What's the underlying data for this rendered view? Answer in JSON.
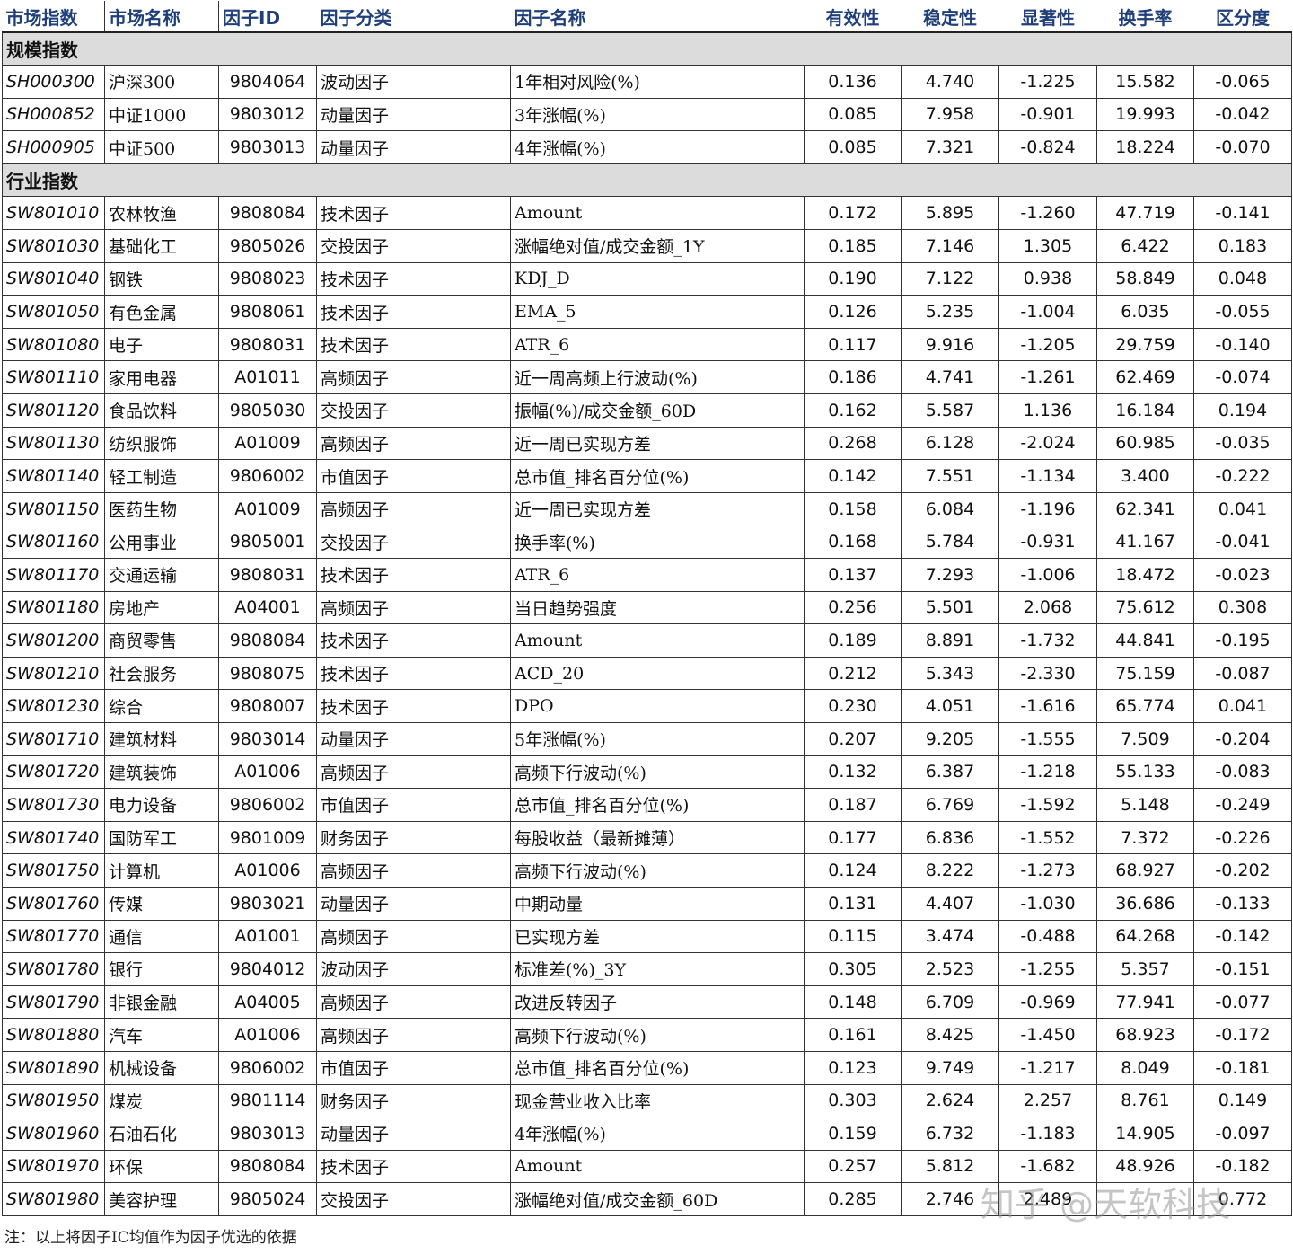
{
  "headers": [
    "市场指数",
    "市场名称",
    "因子ID",
    "因子分类",
    "因子名称",
    "有效性",
    "稳定性",
    "显著性",
    "换手率",
    "区分度"
  ],
  "sections": [
    {
      "title": "规模指数",
      "rows": [
        [
          "SH000300",
          "沪深300",
          "9804064",
          "波动因子",
          "1年相对风险(%)",
          "0.136",
          "4.740",
          "-1.225",
          "15.582",
          "-0.065"
        ],
        [
          "SH000852",
          "中证1000",
          "9803012",
          "动量因子",
          "3年涨幅(%)",
          "0.085",
          "7.958",
          "-0.901",
          "19.993",
          "-0.042"
        ],
        [
          "SH000905",
          "中证500",
          "9803013",
          "动量因子",
          "4年涨幅(%)",
          "0.085",
          "7.321",
          "-0.824",
          "18.224",
          "-0.070"
        ]
      ]
    },
    {
      "title": "行业指数",
      "rows": [
        [
          "SW801010",
          "农林牧渔",
          "9808084",
          "技术因子",
          "Amount",
          "0.172",
          "5.895",
          "-1.260",
          "47.719",
          "-0.141"
        ],
        [
          "SW801030",
          "基础化工",
          "9805026",
          "交投因子",
          "涨幅绝对值/成交金额_1Y",
          "0.185",
          "7.146",
          "1.305",
          "6.422",
          "0.183"
        ],
        [
          "SW801040",
          "钢铁",
          "9808023",
          "技术因子",
          "KDJ_D",
          "0.190",
          "7.122",
          "0.938",
          "58.849",
          "0.048"
        ],
        [
          "SW801050",
          "有色金属",
          "9808061",
          "技术因子",
          "EMA_5",
          "0.126",
          "5.235",
          "-1.004",
          "6.035",
          "-0.055"
        ],
        [
          "SW801080",
          "电子",
          "9808031",
          "技术因子",
          "ATR_6",
          "0.117",
          "9.916",
          "-1.205",
          "29.759",
          "-0.140"
        ],
        [
          "SW801110",
          "家用电器",
          "A01011",
          "高频因子",
          "近一周高频上行波动(%)",
          "0.186",
          "4.741",
          "-1.261",
          "62.469",
          "-0.074"
        ],
        [
          "SW801120",
          "食品饮料",
          "9805030",
          "交投因子",
          "振幅(%)/成交金额_60D",
          "0.162",
          "5.587",
          "1.136",
          "16.184",
          "0.194"
        ],
        [
          "SW801130",
          "纺织服饰",
          "A01009",
          "高频因子",
          "近一周已实现方差",
          "0.268",
          "6.128",
          "-2.024",
          "60.985",
          "-0.035"
        ],
        [
          "SW801140",
          "轻工制造",
          "9806002",
          "市值因子",
          "总市值_排名百分位(%)",
          "0.142",
          "7.551",
          "-1.134",
          "3.400",
          "-0.222"
        ],
        [
          "SW801150",
          "医药生物",
          "A01009",
          "高频因子",
          "近一周已实现方差",
          "0.158",
          "6.084",
          "-1.196",
          "62.341",
          "0.041"
        ],
        [
          "SW801160",
          "公用事业",
          "9805001",
          "交投因子",
          "换手率(%)",
          "0.168",
          "5.784",
          "-0.931",
          "41.167",
          "-0.041"
        ],
        [
          "SW801170",
          "交通运输",
          "9808031",
          "技术因子",
          "ATR_6",
          "0.137",
          "7.293",
          "-1.006",
          "18.472",
          "-0.023"
        ],
        [
          "SW801180",
          "房地产",
          "A04001",
          "高频因子",
          "当日趋势强度",
          "0.256",
          "5.501",
          "2.068",
          "75.612",
          "0.308"
        ],
        [
          "SW801200",
          "商贸零售",
          "9808084",
          "技术因子",
          "Amount",
          "0.189",
          "8.891",
          "-1.732",
          "44.841",
          "-0.195"
        ],
        [
          "SW801210",
          "社会服务",
          "9808075",
          "技术因子",
          "ACD_20",
          "0.212",
          "5.343",
          "-2.330",
          "75.159",
          "-0.087"
        ],
        [
          "SW801230",
          "综合",
          "9808007",
          "技术因子",
          "DPO",
          "0.230",
          "4.051",
          "-1.616",
          "65.774",
          "0.041"
        ],
        [
          "SW801710",
          "建筑材料",
          "9803014",
          "动量因子",
          "5年涨幅(%)",
          "0.207",
          "9.205",
          "-1.555",
          "7.509",
          "-0.204"
        ],
        [
          "SW801720",
          "建筑装饰",
          "A01006",
          "高频因子",
          "高频下行波动(%)",
          "0.132",
          "6.387",
          "-1.218",
          "55.133",
          "-0.083"
        ],
        [
          "SW801730",
          "电力设备",
          "9806002",
          "市值因子",
          "总市值_排名百分位(%)",
          "0.187",
          "6.769",
          "-1.592",
          "5.148",
          "-0.249"
        ],
        [
          "SW801740",
          "国防军工",
          "9801009",
          "财务因子",
          "每股收益（最新摊薄）",
          "0.177",
          "6.836",
          "-1.552",
          "7.372",
          "-0.226"
        ],
        [
          "SW801750",
          "计算机",
          "A01006",
          "高频因子",
          "高频下行波动(%)",
          "0.124",
          "8.222",
          "-1.273",
          "68.927",
          "-0.202"
        ],
        [
          "SW801760",
          "传媒",
          "9803021",
          "动量因子",
          "中期动量",
          "0.131",
          "4.407",
          "-1.030",
          "36.686",
          "-0.133"
        ],
        [
          "SW801770",
          "通信",
          "A01001",
          "高频因子",
          "已实现方差",
          "0.115",
          "3.474",
          "-0.488",
          "64.268",
          "-0.142"
        ],
        [
          "SW801780",
          "银行",
          "9804012",
          "波动因子",
          "标准差(%)_3Y",
          "0.305",
          "2.523",
          "-1.255",
          "5.357",
          "-0.151"
        ],
        [
          "SW801790",
          "非银金融",
          "A04005",
          "高频因子",
          "改进反转因子",
          "0.148",
          "6.709",
          "-0.969",
          "77.941",
          "-0.077"
        ],
        [
          "SW801880",
          "汽车",
          "A01006",
          "高频因子",
          "高频下行波动(%)",
          "0.161",
          "8.425",
          "-1.450",
          "68.923",
          "-0.172"
        ],
        [
          "SW801890",
          "机械设备",
          "9806002",
          "市值因子",
          "总市值_排名百分位(%)",
          "0.123",
          "9.749",
          "-1.217",
          "8.049",
          "-0.181"
        ],
        [
          "SW801950",
          "煤炭",
          "9801114",
          "财务因子",
          "现金营业收入比率",
          "0.303",
          "2.624",
          "2.257",
          "8.761",
          "0.149"
        ],
        [
          "SW801960",
          "石油石化",
          "9803013",
          "动量因子",
          "4年涨幅(%)",
          "0.159",
          "6.732",
          "-1.183",
          "14.905",
          "-0.097"
        ],
        [
          "SW801970",
          "环保",
          "9808084",
          "技术因子",
          "Amount",
          "0.257",
          "5.812",
          "-1.682",
          "48.926",
          "-0.182"
        ],
        [
          "SW801980",
          "美容护理",
          "9805024",
          "交投因子",
          "涨幅绝对值/成交金额_60D",
          "0.285",
          "2.746",
          "2.489",
          "",
          "0.772"
        ]
      ]
    }
  ],
  "footnote": "注：以上将因子IC均值作为因子优选的依据",
  "watermark": "知乎 @天软科技"
}
